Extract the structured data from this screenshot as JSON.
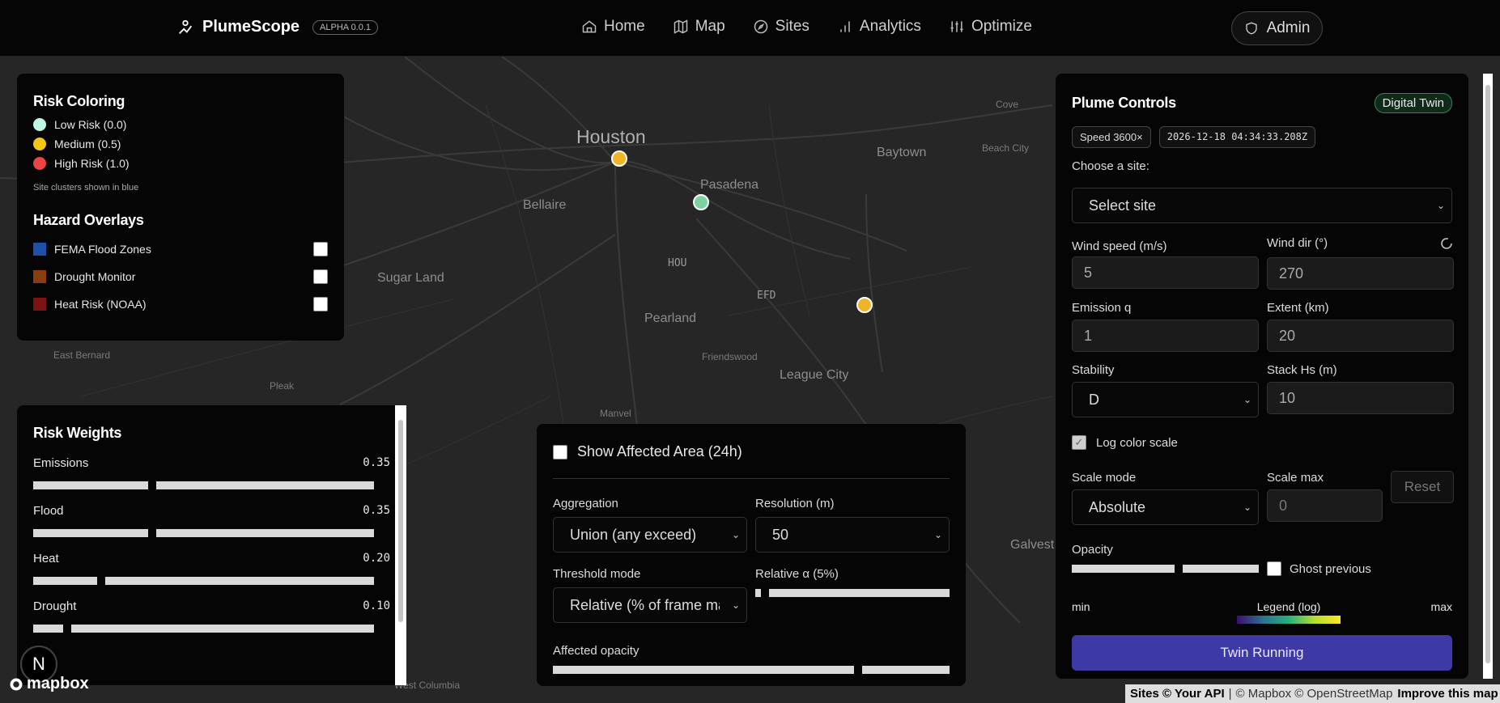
{
  "brand": {
    "name": "PlumeScope",
    "version": "ALPHA 0.0.1"
  },
  "nav": [
    {
      "label": "Home",
      "icon": "home-icon"
    },
    {
      "label": "Map",
      "icon": "map-icon"
    },
    {
      "label": "Sites",
      "icon": "compass-icon"
    },
    {
      "label": "Analytics",
      "icon": "bar-chart-icon"
    },
    {
      "label": "Optimize",
      "icon": "sliders-icon"
    }
  ],
  "admin": {
    "label": "Admin"
  },
  "map": {
    "labels": [
      "Houston",
      "Baytown",
      "Pasadena",
      "Bellaire",
      "Beach City",
      "Cove",
      "HOU",
      "Sugar Land",
      "EFD",
      "Pearland",
      "Friendswood",
      "League City",
      "East Bernard",
      "Pleak",
      "Manvel",
      "West Columbia",
      "Galvest"
    ],
    "site_colors": [
      "#f0b429",
      "#7dd3a0",
      "#f0b429"
    ]
  },
  "risk_coloring": {
    "title": "Risk Coloring",
    "legend": [
      {
        "label": "Low Risk (0.0)",
        "color": "#bff5e4"
      },
      {
        "label": "Medium (0.5)",
        "color": "#f5c518"
      },
      {
        "label": "High Risk (1.0)",
        "color": "#ef4444"
      }
    ],
    "note": "Site clusters shown in blue"
  },
  "hazard_overlays": {
    "title": "Hazard Overlays",
    "items": [
      {
        "label": "FEMA Flood Zones",
        "color": "#1f4fa8"
      },
      {
        "label": "Drought Monitor",
        "color": "#8a3d0f"
      },
      {
        "label": "Heat Risk (NOAA)",
        "color": "#7a1414"
      }
    ]
  },
  "risk_weights": {
    "title": "Risk Weights",
    "items": [
      {
        "label": "Emissions",
        "value": "0.35",
        "level": 0.35
      },
      {
        "label": "Flood",
        "value": "0.35",
        "level": 0.35
      },
      {
        "label": "Heat",
        "value": "0.20",
        "level": 0.2
      },
      {
        "label": "Drought",
        "value": "0.10",
        "level": 0.1
      }
    ]
  },
  "affected": {
    "title": "Show Affected Area (24h)",
    "aggregation_label": "Aggregation",
    "aggregation_value": "Union (any exceed)",
    "resolution_label": "Resolution (m)",
    "resolution_value": "50",
    "threshold_label": "Threshold mode",
    "threshold_value": "Relative (% of frame max)",
    "relative_label": "Relative α (5%)",
    "relative_level": 0.05,
    "opacity_label": "Affected opacity",
    "opacity_level": 0.77
  },
  "plume": {
    "title": "Plume Controls",
    "badge": "Digital Twin",
    "speed": "Speed 3600×",
    "timestamp": "2026-12-18 04:34:33.208Z",
    "choose_label": "Choose a site:",
    "site_select": "Select site",
    "wind_speed_label": "Wind speed (m/s)",
    "wind_speed": "5",
    "wind_dir_label": "Wind dir (°)",
    "wind_dir": "270",
    "emission_label": "Emission q",
    "emission": "1",
    "extent_label": "Extent (km)",
    "extent": "20",
    "stability_label": "Stability",
    "stability": "D",
    "stack_label": "Stack Hs (m)",
    "stack": "10",
    "log_label": "Log color scale",
    "scale_mode_label": "Scale mode",
    "scale_mode": "Absolute",
    "scale_max_label": "Scale max",
    "scale_max_placeholder": "0",
    "reset": "Reset",
    "opacity_label": "Opacity",
    "opacity_level": 0.57,
    "ghost_label": "Ghost previous",
    "legend_min": "min",
    "legend_title": "Legend (log)",
    "legend_max": "max",
    "run_button": "Twin Running"
  },
  "attribution": {
    "sites": "Sites © Your API",
    "sep": "|",
    "rest": "© Mapbox © OpenStreetMap",
    "improve": "Improve this map"
  },
  "mapbox": "mapbox",
  "n_badge": "N"
}
